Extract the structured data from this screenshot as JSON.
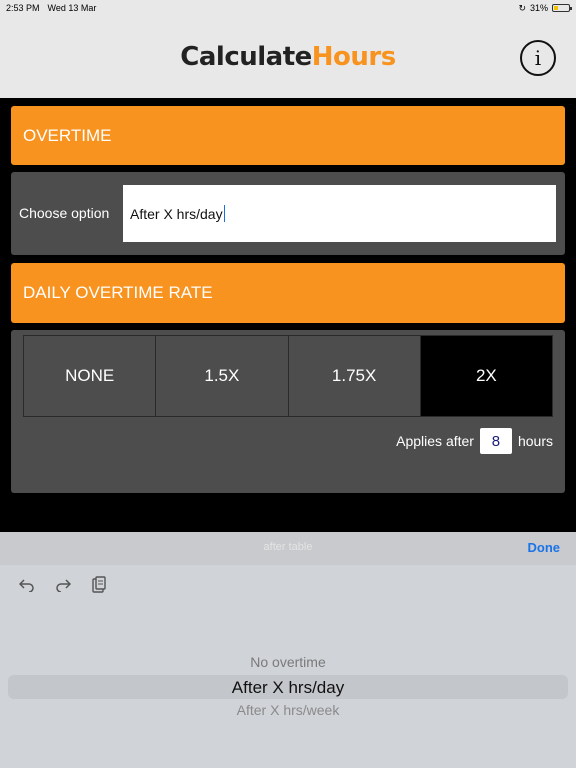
{
  "status_bar": {
    "time": "2:53 PM",
    "date": "Wed 13 Mar",
    "battery_percent": "31%",
    "battery_level": 0.31
  },
  "nav": {
    "logo_part1": "Calculate",
    "logo_part2": "Hours",
    "info_glyph": "i"
  },
  "overtime": {
    "header": "OVERTIME",
    "choose_label": "Choose option",
    "selected_value": "After X hrs/day"
  },
  "daily_rate": {
    "header": "DAILY OVERTIME RATE",
    "options": [
      "NONE",
      "1.5X",
      "1.75X",
      "2X"
    ],
    "active_option": "2X",
    "applies_after_label": "Applies after",
    "hours_value": "8",
    "hours_unit": "hours"
  },
  "picker": {
    "title": "after table",
    "done_label": "Done",
    "items": [
      "No overtime",
      "After X hrs/day",
      "After X hrs/week"
    ],
    "selected_index": 1
  },
  "colors": {
    "accent": "#f7931e",
    "panel": "#4d4d4d",
    "done": "#1a73e8"
  },
  "icons": {
    "undo": "undo-icon",
    "redo": "redo-icon",
    "paste": "clipboard-icon",
    "info": "info-icon"
  }
}
